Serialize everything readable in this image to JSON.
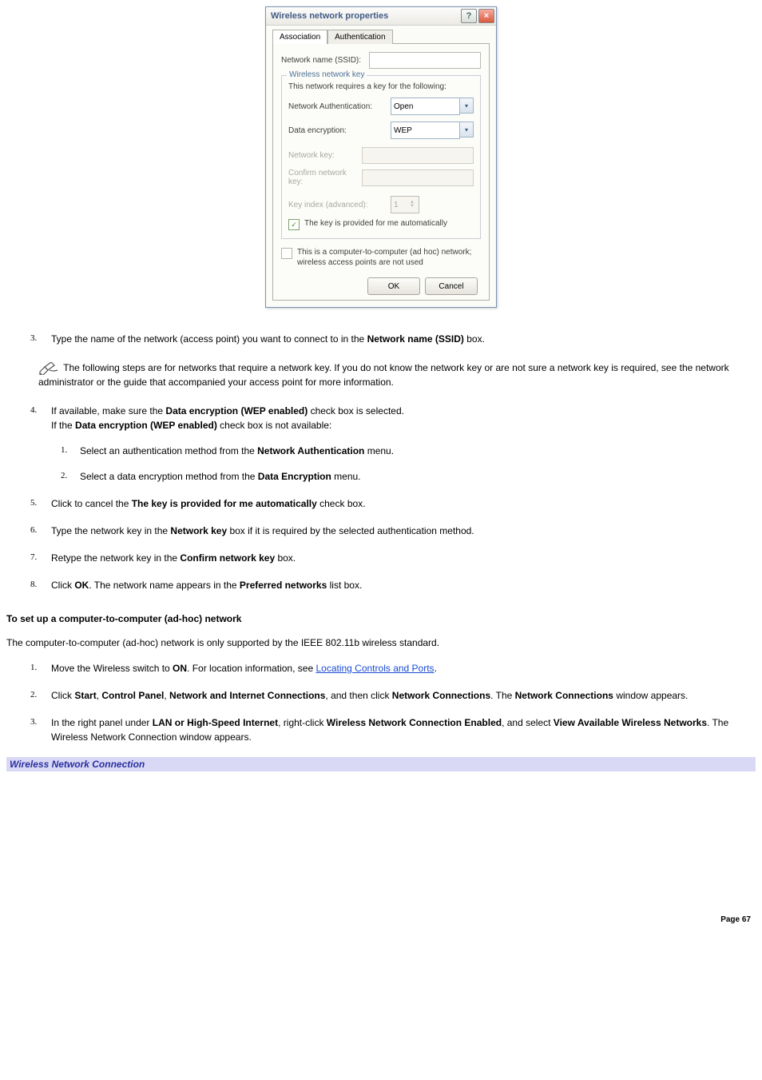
{
  "dialog": {
    "title": "Wireless network properties",
    "tabs": {
      "association": "Association",
      "authentication": "Authentication"
    },
    "ssid_label": "Network name (SSID):",
    "ssid_value": "",
    "fieldset_legend": "Wireless network key",
    "requires_text": "This network requires a key for the following:",
    "auth_label": "Network Authentication:",
    "auth_value": "Open",
    "enc_label": "Data encryption:",
    "enc_value": "WEP",
    "key_label": "Network key:",
    "confirm_key_label": "Confirm network key:",
    "key_index_label": "Key index (advanced):",
    "key_index_value": "1",
    "auto_key_chk": "The key is provided for me automatically",
    "adhoc_chk": "This is a computer-to-computer (ad hoc) network; wireless access points are not used",
    "ok_btn": "OK",
    "cancel_btn": "Cancel"
  },
  "steps_a": {
    "s3_pre": "Type the name of the network (access point) you want to connect to in the ",
    "s3_b": "Network name (SSID)",
    "s3_post": " box.",
    "note": " The following steps are for networks that require a network key. If you do not know the network key or are not sure a network key is required, see the network administrator or the guide that accompanied your access point for more information.",
    "s4_pre": "If available, make sure the ",
    "s4_b1": "Data encryption (WEP enabled)",
    "s4_mid": " check box is selected.",
    "s4_line2_pre": "If the ",
    "s4_line2_b": "Data encryption (WEP enabled)",
    "s4_line2_post": " check box is not available:",
    "s4_1_pre": "Select an authentication method from the ",
    "s4_1_b": "Network Authentication",
    "s4_1_post": " menu.",
    "s4_2_pre": "Select a data encryption method from the ",
    "s4_2_b": "Data Encryption",
    "s4_2_post": " menu.",
    "s5_pre": "Click to cancel the ",
    "s5_b": "The key is provided for me automatically",
    "s5_post": " check box.",
    "s6_pre": "Type the network key in the ",
    "s6_b": "Network key",
    "s6_post": " box if it is required by the selected authentication method.",
    "s7_pre": "Retype the network key in the ",
    "s7_b": "Confirm network key",
    "s7_post": " box.",
    "s8_pre": "Click ",
    "s8_b1": "OK",
    "s8_mid": ". The network name appears in the ",
    "s8_b2": "Preferred networks",
    "s8_post": " list box."
  },
  "section2": {
    "heading": "To set up a computer-to-computer (ad-hoc) network",
    "intro": "The computer-to-computer (ad-hoc) network is only supported by the IEEE 802.11b wireless standard.",
    "s1_pre": "Move the Wireless switch to ",
    "s1_b": "ON",
    "s1_mid": ". For location information, see ",
    "s1_link": "Locating Controls and Ports",
    "s1_post": ".",
    "s2_pre": "Click ",
    "s2_b1": "Start",
    "s2_c1": ", ",
    "s2_b2": "Control Panel",
    "s2_c2": ", ",
    "s2_b3": "Network and Internet Connections",
    "s2_mid": ", and then click ",
    "s2_b4": "Network Connections",
    "s2_mid2": ". The ",
    "s2_b5": "Network Connections",
    "s2_post": " window appears.",
    "s3_pre": "In the right panel under ",
    "s3_b1": "LAN or High-Speed Internet",
    "s3_mid1": ", right-click ",
    "s3_b2": "Wireless Network Connection Enabled",
    "s3_mid2": ", and select ",
    "s3_b3": "View Available Wireless Networks",
    "s3_post": ". The Wireless Network Connection window appears."
  },
  "caption": "Wireless Network Connection",
  "page_footer": "Page 67"
}
